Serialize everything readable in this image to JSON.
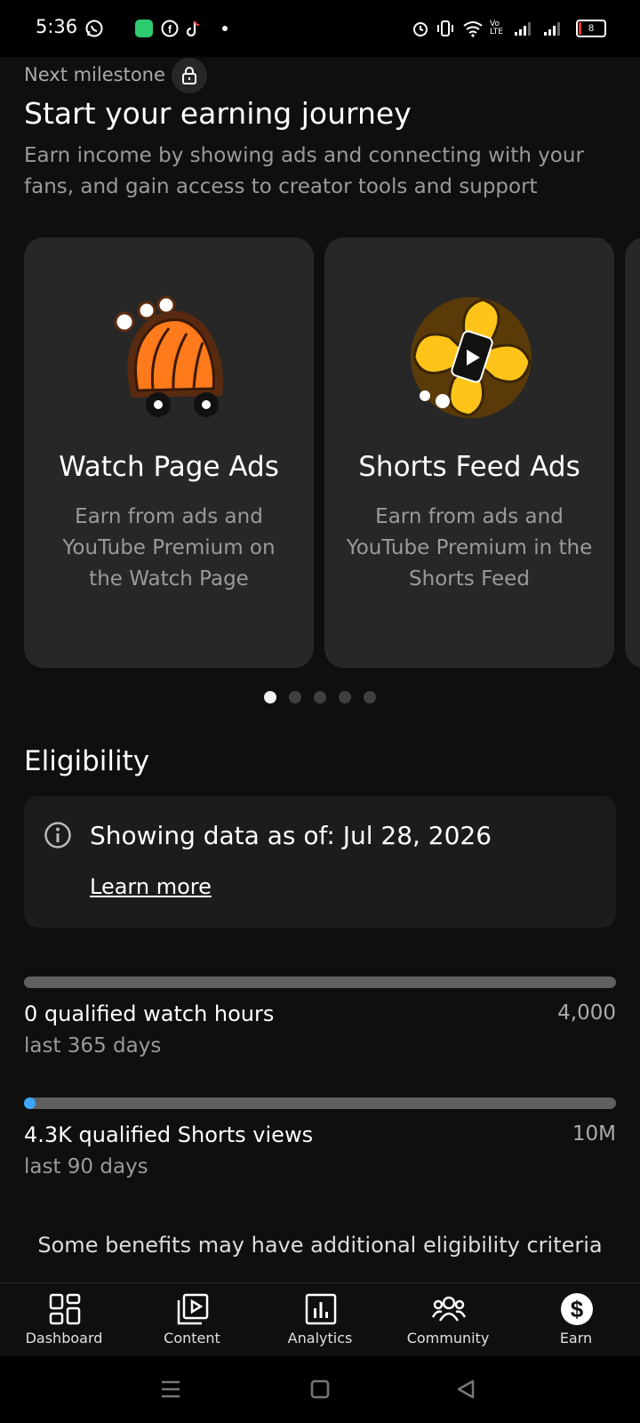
{
  "status_bar": {
    "time": "5:36",
    "battery": "8",
    "network": "Vo LTE"
  },
  "milestone": {
    "label": "Next milestone",
    "headline": "Start your earning journey",
    "description": "Earn income by showing ads and connecting with your fans, and gain access to creator tools and support"
  },
  "cards": [
    {
      "title": "Watch Page Ads",
      "description": "Earn from ads and YouTube Premium on the Watch Page",
      "icon": "popcorn-cart-icon"
    },
    {
      "title": "Shorts Feed Ads",
      "description": "Earn from ads and YouTube Premium in the Shorts Feed",
      "icon": "shorts-pinwheel-icon"
    }
  ],
  "carousel": {
    "page_count": 5,
    "active_index": 0
  },
  "eligibility": {
    "title": "Eligibility",
    "info_text": "Showing data as of: Jul 28, 2026",
    "learn_more": "Learn more",
    "metrics": [
      {
        "label": "0 qualified watch hours",
        "period": "last 365 days",
        "target": "4,000",
        "progress": 0
      },
      {
        "label": "4.3K qualified Shorts views",
        "period": "last 90 days",
        "target": "10M",
        "progress": 0.00043
      }
    ],
    "note": "Some benefits may have additional eligibility criteria"
  },
  "colors": {
    "progress_fill": "#3ea6ff",
    "background": "#0f0f0f",
    "card": "#272727"
  },
  "bottom_nav": [
    {
      "label": "Dashboard",
      "icon": "dashboard-icon"
    },
    {
      "label": "Content",
      "icon": "content-icon"
    },
    {
      "label": "Analytics",
      "icon": "analytics-icon"
    },
    {
      "label": "Community",
      "icon": "community-icon"
    },
    {
      "label": "Earn",
      "icon": "earn-dollar-icon",
      "selected": true
    }
  ]
}
